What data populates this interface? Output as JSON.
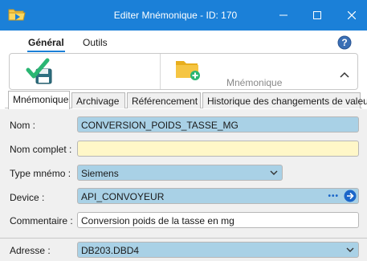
{
  "window": {
    "title": "Editer Mnémonique - ID: 170"
  },
  "ribbon_tabs": [
    "Général",
    "Outils"
  ],
  "ribbon": {
    "mnemonique_label": "Mnémonique"
  },
  "tabs": [
    "Mnémonique",
    "Archivage",
    "Référencement",
    "Historique des changements de valeur"
  ],
  "form": {
    "nom_label": "Nom :",
    "nom_value": "CONVERSION_POIDS_TASSE_MG",
    "nom_complet_label": "Nom complet :",
    "nom_complet_value": "",
    "type_label": "Type mnémo :",
    "type_value": "Siemens",
    "device_label": "Device :",
    "device_value": "API_CONVOYEUR",
    "commentaire_label": "Commentaire :",
    "commentaire_value": "Conversion poids de la tasse en mg",
    "adresse_label": "Adresse :",
    "adresse_value": "DB203.DBD4"
  },
  "colors": {
    "titlebar": "#1b80d8",
    "field_blue": "#a9d1e6",
    "field_yellow": "#fff7c8"
  }
}
